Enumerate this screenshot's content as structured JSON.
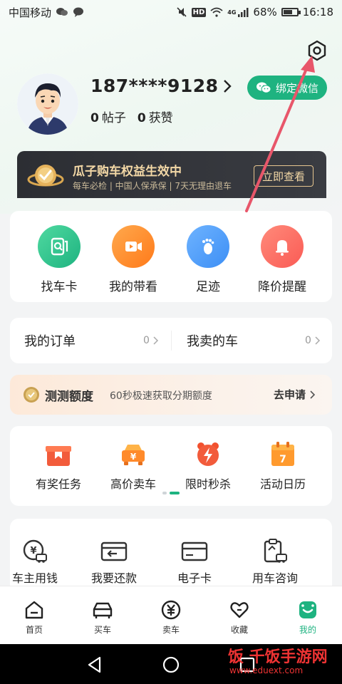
{
  "status_bar": {
    "carrier": "中国移动",
    "hd": "HD",
    "net": "4G",
    "battery": "68%",
    "battery_level": 0.68,
    "time": "16:18"
  },
  "profile": {
    "phone": "187****9128",
    "posts_count": "0",
    "posts_label": "帖子",
    "likes_count": "0",
    "likes_label": "获赞",
    "bind_wechat_label": "绑定微信"
  },
  "banner": {
    "title": "瓜子购车权益生效中",
    "subtitle": "每车必检 | 中国人保承保 | 7天无理由退车",
    "button": "立即查看"
  },
  "quick_actions": [
    {
      "label": "找车卡",
      "icon": "car-card-icon",
      "color": "#2ec68a"
    },
    {
      "label": "我的带看",
      "icon": "video-icon",
      "color": "#ff8a2b"
    },
    {
      "label": "足迹",
      "icon": "footprint-icon",
      "color": "#3d8ff5"
    },
    {
      "label": "降价提醒",
      "icon": "bell-icon",
      "color": "#fa5b55"
    }
  ],
  "orders": {
    "my_orders_label": "我的订单",
    "my_orders_count": "0",
    "sold_cars_label": "我卖的车",
    "sold_cars_count": "0"
  },
  "credit": {
    "title": "测测额度",
    "subtitle": "60秒极速获取分期额度",
    "link": "去申请"
  },
  "promos": [
    {
      "label": "有奖任务",
      "icon": "gift-icon"
    },
    {
      "label": "高价卖车",
      "icon": "sell-car-icon"
    },
    {
      "label": "限时秒杀",
      "icon": "flash-sale-icon"
    },
    {
      "label": "活动日历",
      "icon": "calendar-icon"
    }
  ],
  "services": [
    {
      "label": "车主用钱",
      "icon": "car-loan-icon"
    },
    {
      "label": "我要还款",
      "icon": "repay-icon"
    },
    {
      "label": "电子卡",
      "icon": "e-card-icon"
    },
    {
      "label": "用车咨询",
      "icon": "consult-icon"
    }
  ],
  "tabs": [
    {
      "label": "首页",
      "icon": "home-icon"
    },
    {
      "label": "买车",
      "icon": "buy-car-icon"
    },
    {
      "label": "卖车",
      "icon": "sell-icon"
    },
    {
      "label": "收藏",
      "icon": "favorite-icon"
    },
    {
      "label": "我的",
      "icon": "profile-icon",
      "active": true
    }
  ],
  "watermark": {
    "title": "饭 千饭手游网",
    "url": "www.eduext.com"
  },
  "colors": {
    "brand_green": "#1eb380",
    "banner_dark": "#2c2e33",
    "banner_gold": "#f3d8a6",
    "arrow_red": "#e8566a"
  }
}
